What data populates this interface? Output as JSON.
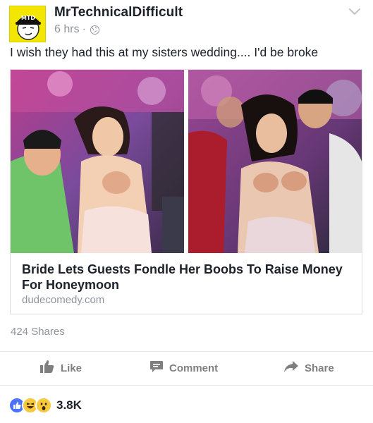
{
  "post": {
    "page_name": "MrTechnicalDifficult",
    "avatar_text": "MTD",
    "time": "6 hrs",
    "separator": "·",
    "text": "I wish they had this at my sisters wedding.... I'd be broke"
  },
  "link_card": {
    "title": "Bride Lets Guests Fondle Her Boobs To Raise Money For Honeymoon",
    "domain": "dudecomedy.com"
  },
  "stats": {
    "shares": "424 Shares",
    "reactions_count": "3.8K"
  },
  "actions": {
    "like": "Like",
    "comment": "Comment",
    "share": "Share"
  },
  "icons": {
    "privacy": "globe-icon",
    "menu": "chevron-down-icon",
    "like": "thumbs-up-icon",
    "comment": "speech-bubble-icon",
    "share": "share-arrow-icon",
    "reactions": [
      "like",
      "haha",
      "wow"
    ]
  },
  "colors": {
    "text": "#1d2129",
    "muted": "#90949c",
    "action": "#7f7f7f",
    "avatar_bg": "#f3e600",
    "reaction_like": "#4c73ff",
    "reaction_face": "#f8c93c"
  }
}
